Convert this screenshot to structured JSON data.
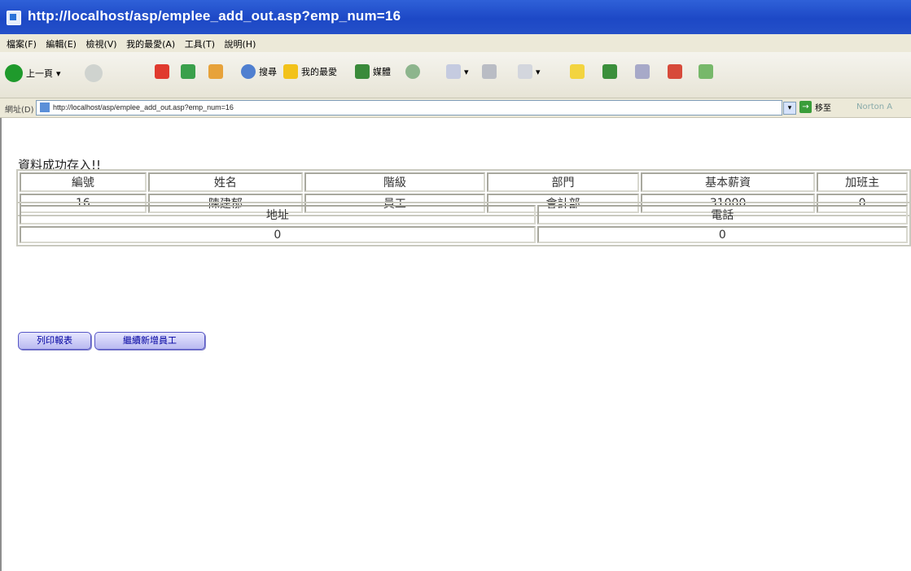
{
  "window": {
    "title": "http://localhost/asp/emplee_add_out.asp?emp_num=16"
  },
  "menu": [
    "檔案(F)",
    "編輯(E)",
    "檢視(V)",
    "我的最愛(A)",
    "工具(T)",
    "說明(H)"
  ],
  "toolbar": {
    "back_label": "上一頁",
    "search_label": "搜尋",
    "favorites_label": "我的最愛",
    "media_label": "媒體"
  },
  "address": {
    "label": "網址(D)",
    "url": "http://localhost/asp/emplee_add_out.asp?emp_num=16",
    "go_label": "移至",
    "links_label": "Norton A"
  },
  "message": "資料成功存入!!",
  "employee_table": {
    "headers": [
      "編號",
      "姓名",
      "階級",
      "部門",
      "基本薪資",
      "加班主"
    ],
    "values": [
      "16",
      "陳建郁",
      "員工",
      "會計部",
      "31000",
      "0"
    ]
  },
  "contact_table": {
    "headers": [
      "地址",
      "電話"
    ],
    "values": [
      "0",
      "0"
    ]
  },
  "buttons": {
    "print_report": "列印報表",
    "add_employee": "繼續新增員工"
  },
  "colors": {
    "titlebar": "#2454cc",
    "button_border": "#5555c5",
    "button_text": "#0000a0"
  }
}
